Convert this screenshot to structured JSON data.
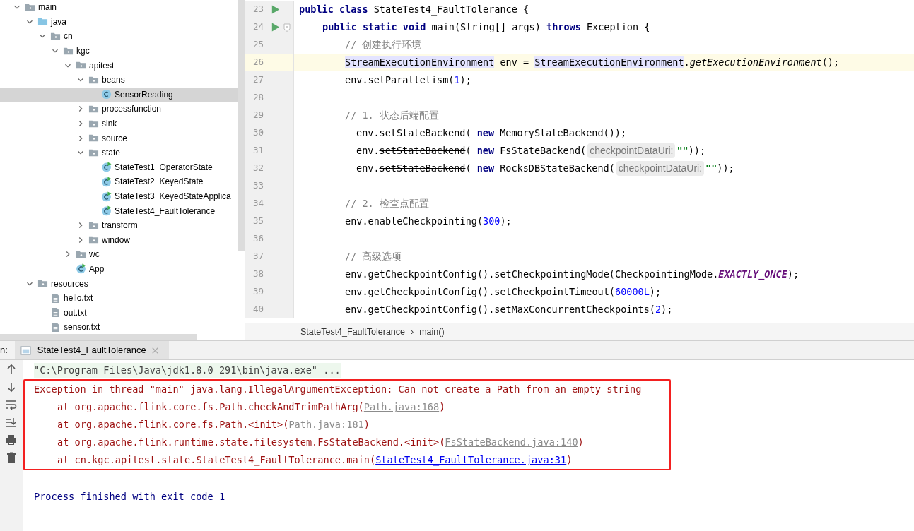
{
  "project_tree": [
    {
      "label": "main",
      "kind": "folder",
      "expanded": true,
      "selected": false,
      "children": [
        {
          "label": "java",
          "kind": "source-folder",
          "expanded": true,
          "selected": false,
          "children": [
            {
              "label": "cn",
              "kind": "folder",
              "expanded": true,
              "selected": false,
              "children": [
                {
                  "label": "kgc",
                  "kind": "folder",
                  "expanded": true,
                  "selected": false,
                  "children": [
                    {
                      "label": "apitest",
                      "kind": "folder",
                      "expanded": true,
                      "selected": false,
                      "children": [
                        {
                          "label": "beans",
                          "kind": "folder",
                          "expanded": true,
                          "selected": false,
                          "children": [
                            {
                              "label": "SensorReading",
                              "kind": "class",
                              "selected": true
                            }
                          ]
                        },
                        {
                          "label": "processfunction",
                          "kind": "folder",
                          "expanded": false,
                          "selected": false
                        },
                        {
                          "label": "sink",
                          "kind": "folder",
                          "expanded": false,
                          "selected": false
                        },
                        {
                          "label": "source",
                          "kind": "folder",
                          "expanded": false,
                          "selected": false
                        },
                        {
                          "label": "state",
                          "kind": "folder",
                          "expanded": true,
                          "selected": false,
                          "children": [
                            {
                              "label": "StateTest1_OperatorState",
                              "kind": "runnable-class",
                              "selected": false
                            },
                            {
                              "label": "StateTest2_KeyedState",
                              "kind": "runnable-class",
                              "selected": false
                            },
                            {
                              "label": "StateTest3_KeyedStateApplica",
                              "kind": "runnable-class",
                              "selected": false
                            },
                            {
                              "label": "StateTest4_FaultTolerance",
                              "kind": "runnable-class",
                              "selected": false
                            }
                          ]
                        },
                        {
                          "label": "transform",
                          "kind": "folder",
                          "expanded": false,
                          "selected": false
                        },
                        {
                          "label": "window",
                          "kind": "folder",
                          "expanded": false,
                          "selected": false
                        }
                      ]
                    },
                    {
                      "label": "wc",
                      "kind": "folder",
                      "expanded": false,
                      "selected": false
                    },
                    {
                      "label": "App",
                      "kind": "runnable-class",
                      "selected": false
                    }
                  ]
                }
              ]
            }
          ]
        },
        {
          "label": "resources",
          "kind": "folder",
          "expanded": true,
          "selected": false,
          "children": [
            {
              "label": "hello.txt",
              "kind": "file",
              "selected": false
            },
            {
              "label": "out.txt",
              "kind": "file",
              "selected": false
            },
            {
              "label": "sensor.txt",
              "kind": "file",
              "selected": false
            }
          ]
        }
      ]
    }
  ],
  "editor": {
    "lines": [
      {
        "number": "23",
        "run": true,
        "fold": false,
        "current": false,
        "kind": "class",
        "tokens": [
          {
            "kind": "keyword",
            "text": "public class "
          },
          {
            "kind": "plain",
            "text": "StateTest4_FaultTolerance {"
          }
        ]
      },
      {
        "number": "24",
        "run": true,
        "fold": true,
        "current": false,
        "kind": "method",
        "tokens": [
          {
            "kind": "keyword",
            "text": "public static void "
          },
          {
            "kind": "plain",
            "text": "main(String[] args) "
          },
          {
            "kind": "keyword",
            "text": "throws "
          },
          {
            "kind": "plain",
            "text": "Exception {"
          }
        ]
      },
      {
        "number": "25",
        "run": false,
        "fold": false,
        "current": false,
        "kind": "statement",
        "tokens": [
          {
            "kind": "comment",
            "text": "// 创建执行环境"
          }
        ]
      },
      {
        "number": "26",
        "run": false,
        "fold": false,
        "current": true,
        "kind": "statement",
        "tokens": [
          {
            "kind": "usage",
            "text": "StreamExecutionEnvironment"
          },
          {
            "kind": "plain",
            "text": " env = "
          },
          {
            "kind": "usage",
            "text": "StreamExecutionEnvironment"
          },
          {
            "kind": "plain",
            "text": "."
          },
          {
            "kind": "static",
            "text": "getExecutionEnvironment"
          },
          {
            "kind": "plain",
            "text": "();"
          }
        ]
      },
      {
        "number": "27",
        "run": false,
        "fold": false,
        "current": false,
        "kind": "statement",
        "tokens": [
          {
            "kind": "plain",
            "text": "env.setParallelism("
          },
          {
            "kind": "number",
            "text": "1"
          },
          {
            "kind": "plain",
            "text": ");"
          }
        ]
      },
      {
        "number": "28",
        "run": false,
        "fold": false,
        "current": false,
        "kind": "blank"
      },
      {
        "number": "29",
        "run": false,
        "fold": false,
        "current": false,
        "kind": "statement",
        "tokens": [
          {
            "kind": "comment",
            "text": "// 1. 状态后端配置"
          }
        ]
      },
      {
        "number": "30",
        "run": false,
        "fold": false,
        "current": false,
        "kind": "nested",
        "tokens": [
          {
            "kind": "plain",
            "text": "env."
          },
          {
            "kind": "deprecated",
            "text": "setStateBackend"
          },
          {
            "kind": "plain",
            "text": "( "
          },
          {
            "kind": "keyword",
            "text": "new "
          },
          {
            "kind": "plain",
            "text": "MemoryStateBackend());"
          }
        ]
      },
      {
        "number": "31",
        "run": false,
        "fold": false,
        "current": false,
        "kind": "nested",
        "tokens": [
          {
            "kind": "plain",
            "text": "env."
          },
          {
            "kind": "deprecated",
            "text": "setStateBackend"
          },
          {
            "kind": "plain",
            "text": "( "
          },
          {
            "kind": "keyword",
            "text": "new "
          },
          {
            "kind": "plain",
            "text": "FsStateBackend("
          },
          {
            "kind": "hint",
            "text": "checkpointDataUri:"
          },
          {
            "kind": "string",
            "text": "\"\""
          },
          {
            "kind": "plain",
            "text": "));"
          }
        ]
      },
      {
        "number": "32",
        "run": false,
        "fold": false,
        "current": false,
        "kind": "nested",
        "tokens": [
          {
            "kind": "plain",
            "text": "env."
          },
          {
            "kind": "deprecated",
            "text": "setStateBackend"
          },
          {
            "kind": "plain",
            "text": "( "
          },
          {
            "kind": "keyword",
            "text": "new "
          },
          {
            "kind": "plain",
            "text": "RocksDBStateBackend("
          },
          {
            "kind": "hint",
            "text": "checkpointDataUri:"
          },
          {
            "kind": "string",
            "text": "\"\""
          },
          {
            "kind": "plain",
            "text": "));"
          }
        ]
      },
      {
        "number": "33",
        "run": false,
        "fold": false,
        "current": false,
        "kind": "blank"
      },
      {
        "number": "34",
        "run": false,
        "fold": false,
        "current": false,
        "kind": "statement",
        "tokens": [
          {
            "kind": "comment",
            "text": "// 2. 检查点配置"
          }
        ]
      },
      {
        "number": "35",
        "run": false,
        "fold": false,
        "current": false,
        "kind": "statement",
        "tokens": [
          {
            "kind": "plain",
            "text": "env.enableCheckpointing("
          },
          {
            "kind": "number",
            "text": "300"
          },
          {
            "kind": "plain",
            "text": ");"
          }
        ]
      },
      {
        "number": "36",
        "run": false,
        "fold": false,
        "current": false,
        "kind": "blank"
      },
      {
        "number": "37",
        "run": false,
        "fold": false,
        "current": false,
        "kind": "statement",
        "tokens": [
          {
            "kind": "comment",
            "text": "// 高级选项"
          }
        ]
      },
      {
        "number": "38",
        "run": false,
        "fold": false,
        "current": false,
        "kind": "statement",
        "tokens": [
          {
            "kind": "plain",
            "text": "env.getCheckpointConfig().setCheckpointingMode(CheckpointingMode."
          },
          {
            "kind": "constant",
            "text": "EXACTLY_ONCE"
          },
          {
            "kind": "plain",
            "text": ");"
          }
        ]
      },
      {
        "number": "39",
        "run": false,
        "fold": false,
        "current": false,
        "kind": "statement",
        "tokens": [
          {
            "kind": "plain",
            "text": "env.getCheckpointConfig().setCheckpointTimeout("
          },
          {
            "kind": "number",
            "text": "60000L"
          },
          {
            "kind": "plain",
            "text": ");"
          }
        ]
      },
      {
        "number": "40",
        "run": false,
        "fold": false,
        "current": false,
        "kind": "statement",
        "tokens": [
          {
            "kind": "plain",
            "text": "env.getCheckpointConfig().setMaxConcurrentCheckpoints("
          },
          {
            "kind": "number",
            "text": "2"
          },
          {
            "kind": "plain",
            "text": ");"
          }
        ]
      }
    ],
    "breadcrumb": [
      "StateTest4_FaultTolerance",
      "›",
      "main()"
    ]
  },
  "run_panel": {
    "label": "n:",
    "tab": {
      "title": "StateTest4_FaultTolerance",
      "selected": true
    },
    "toolbar": [
      {
        "kind": "up"
      },
      {
        "kind": "down"
      },
      {
        "kind": "wrap"
      },
      {
        "kind": "scroll-end"
      },
      {
        "kind": "print"
      },
      {
        "kind": "trash"
      }
    ],
    "command": "\"C:\\Program Files\\Java\\jdk1.8.0_291\\bin\\java.exe\" ...",
    "error_block": {
      "framed": true,
      "lines": [
        {
          "kind": "message",
          "parts": [
            {
              "kind": "error",
              "text": "Exception in thread \"main\" java.lang.IllegalArgumentException: Can not create a Path from an empty string"
            }
          ]
        },
        {
          "kind": "frame",
          "parts": [
            {
              "kind": "error",
              "text": "at org.apache.flink.core.fs.Path.checkAndTrimPathArg("
            },
            {
              "kind": "library-link",
              "text": "Path.java:168"
            },
            {
              "kind": "error",
              "text": ")"
            }
          ]
        },
        {
          "kind": "frame",
          "parts": [
            {
              "kind": "error",
              "text": "at org.apache.flink.core.fs.Path.<init>("
            },
            {
              "kind": "library-link",
              "text": "Path.java:181"
            },
            {
              "kind": "error",
              "text": ")"
            }
          ]
        },
        {
          "kind": "frame",
          "parts": [
            {
              "kind": "error",
              "text": "at org.apache.flink.runtime.state.filesystem.FsStateBackend.<init>("
            },
            {
              "kind": "library-link",
              "text": "FsStateBackend.java:140"
            },
            {
              "kind": "error",
              "text": ")"
            }
          ]
        },
        {
          "kind": "frame",
          "parts": [
            {
              "kind": "error",
              "text": "at cn.kgc.apitest.state.StateTest4_FaultTolerance.main("
            },
            {
              "kind": "user-link",
              "text": "StateTest4_FaultTolerance.java:31"
            },
            {
              "kind": "error",
              "text": ")"
            }
          ]
        }
      ]
    },
    "exit_message": "Process finished with exit code 1"
  }
}
